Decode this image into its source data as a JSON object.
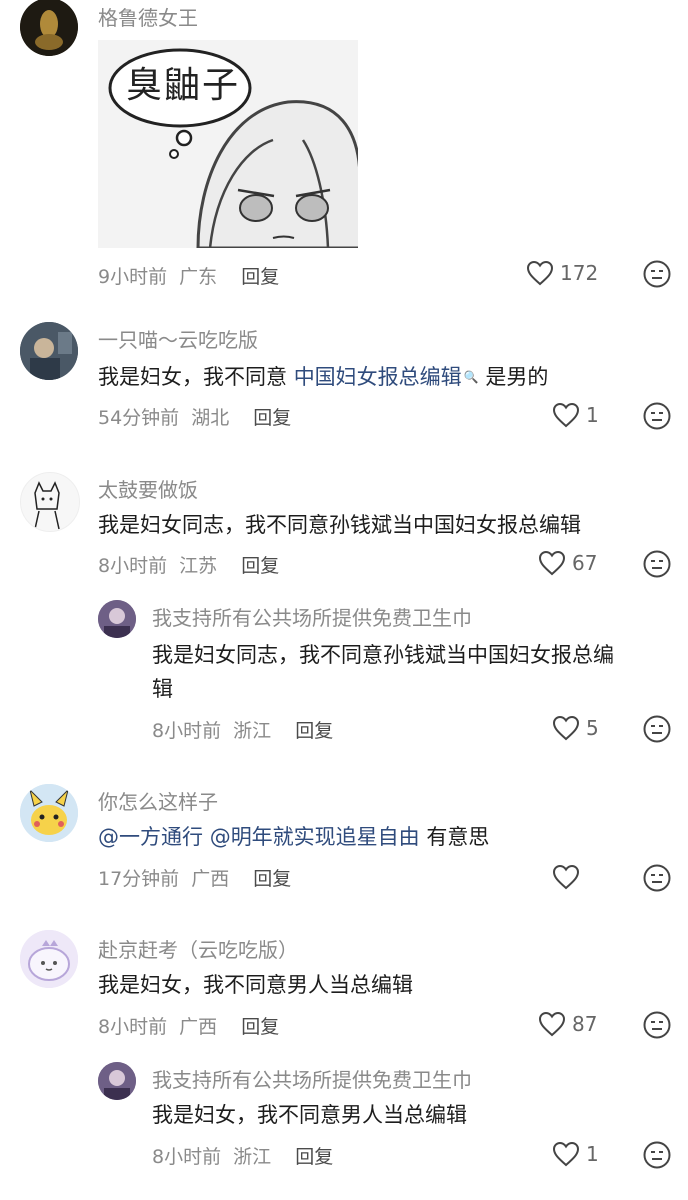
{
  "comments": [
    {
      "username": "格鲁德女王",
      "sticker_text": "臭鼬子",
      "time": "9小时前",
      "location": "广东",
      "reply_label": "回复",
      "likes": "172",
      "avatar_color": "#2a2418"
    },
    {
      "username": "一只喵～云吃吃版",
      "text_before": "我是妇女，我不同意",
      "link_text": "中国妇女报总编辑",
      "text_after": "是男的",
      "time": "54分钟前",
      "location": "湖北",
      "reply_label": "回复",
      "likes": "1",
      "avatar_color": "#3a4a5a"
    },
    {
      "username": "太鼓要做饭",
      "text": "我是妇女同志，我不同意孙钱斌当中国妇女报总编辑",
      "time": "8小时前",
      "location": "江苏",
      "reply_label": "回复",
      "likes": "67",
      "avatar_color": "#f4f4f4"
    },
    {
      "username": "我支持所有公共场所提供免费卫生巾",
      "text_line1": "我是妇女同志，我不同意孙钱斌当中国妇女报总编",
      "text_line2": "辑",
      "time": "8小时前",
      "location": "浙江",
      "reply_label": "回复",
      "likes": "5",
      "avatar_color": "#7a6a8e"
    },
    {
      "username": "你怎么这样子",
      "mention1": "@一方通行",
      "mention2": "@明年就实现追星自由",
      "text_after": "有意思",
      "time": "17分钟前",
      "location": "广西",
      "reply_label": "回复",
      "likes": "",
      "avatar_color": "#cfe3f2"
    },
    {
      "username": "赴京赶考（云吃吃版）",
      "text": "我是妇女，我不同意男人当总编辑",
      "time": "8小时前",
      "location": "广西",
      "reply_label": "回复",
      "likes": "87",
      "avatar_color": "#ece6f7"
    },
    {
      "username": "我支持所有公共场所提供免费卫生巾",
      "text": "我是妇女，我不同意男人当总编辑",
      "time": "8小时前",
      "location": "浙江",
      "reply_label": "回复",
      "likes": "1",
      "avatar_color": "#7a6a8e"
    }
  ]
}
